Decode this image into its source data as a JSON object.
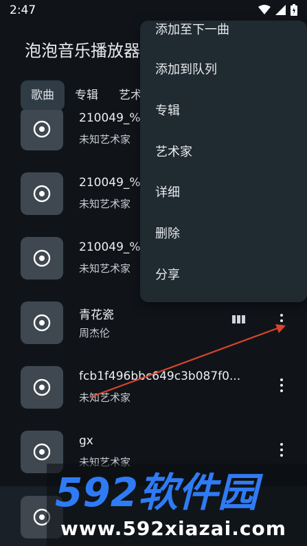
{
  "status": {
    "time": "2:47"
  },
  "app": {
    "title": "泡泡音乐播放器"
  },
  "tabs": [
    {
      "label": "歌曲",
      "active": true
    },
    {
      "label": "专辑"
    },
    {
      "label": "艺术家"
    }
  ],
  "songs": [
    {
      "title": "210049_%",
      "artist": "未知艺术家"
    },
    {
      "title": "210049_%",
      "artist": "未知艺术家"
    },
    {
      "title": "210049_%",
      "artist": "未知艺术家"
    },
    {
      "title": "青花瓷",
      "artist": "周杰伦",
      "playing": true
    },
    {
      "title": "fcb1f496bbc649c3b087f0...",
      "artist": "未知艺术家"
    },
    {
      "title": "gx",
      "artist": "未知艺术家"
    }
  ],
  "menu": {
    "items": [
      {
        "label": "添加至下一曲"
      },
      {
        "label": "添加到队列"
      },
      {
        "label": "专辑"
      },
      {
        "label": "艺术家"
      },
      {
        "label": "详细"
      },
      {
        "label": "删除"
      },
      {
        "label": "分享"
      }
    ]
  },
  "watermark": {
    "logo": "592软件园",
    "url": "www.592xiazai.com"
  },
  "colors": {
    "background": "#101419",
    "active_tab": "#2f3b45",
    "menu_bg": "#202a31",
    "arrow": "#d9442b",
    "watermark_blue": "#2f7bf5"
  },
  "icons": {
    "art": "disc-icon",
    "more": "more-vertical-icon",
    "playing": "equalizer-icon"
  }
}
